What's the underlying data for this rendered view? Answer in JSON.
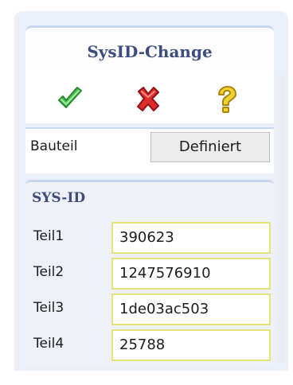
{
  "dialog": {
    "title": "SysID-Change",
    "actions": [
      {
        "icon": "check-icon",
        "color": "#3bb34a"
      },
      {
        "icon": "close-icon",
        "color": "#d82020"
      },
      {
        "icon": "help-icon",
        "color": "#e8c21c"
      }
    ]
  },
  "bauteil": {
    "label": "Bauteil",
    "value": "Definiert"
  },
  "sysid": {
    "title": "SYS-ID",
    "rows": [
      {
        "label": "Teil1",
        "value": "390623"
      },
      {
        "label": "Teil2",
        "value": "1247576910"
      },
      {
        "label": "Teil3",
        "value": "1de03ac503"
      },
      {
        "label": "Teil4",
        "value": "25788"
      }
    ]
  },
  "colors": {
    "accent": "#3d4e7e",
    "field_border": "#e3e47a",
    "panel_bg": "#ebeff8"
  }
}
